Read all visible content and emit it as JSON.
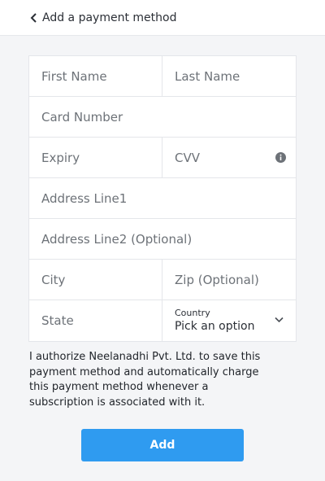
{
  "header": {
    "title": "Add a payment method"
  },
  "form": {
    "first_name_placeholder": "First Name",
    "last_name_placeholder": "Last Name",
    "card_number_placeholder": "Card Number",
    "expiry_placeholder": "Expiry",
    "cvv_placeholder": "CVV",
    "address1_placeholder": "Address Line1",
    "address2_placeholder": "Address Line2 (Optional)",
    "city_placeholder": "City",
    "zip_placeholder": "Zip (Optional)",
    "state_placeholder": "State",
    "country": {
      "label": "Country",
      "value": "Pick an option"
    }
  },
  "consent_text": "I authorize Neelanadhi Pvt. Ltd. to save this payment method and automatically charge this payment method whenever a subscription is associated with it.",
  "add_button_label": "Add",
  "colors": {
    "accent": "#2f9bf0",
    "background": "#f4f5f7"
  },
  "icons": [
    "chevron-left-icon",
    "info-icon",
    "chevron-down-icon"
  ]
}
